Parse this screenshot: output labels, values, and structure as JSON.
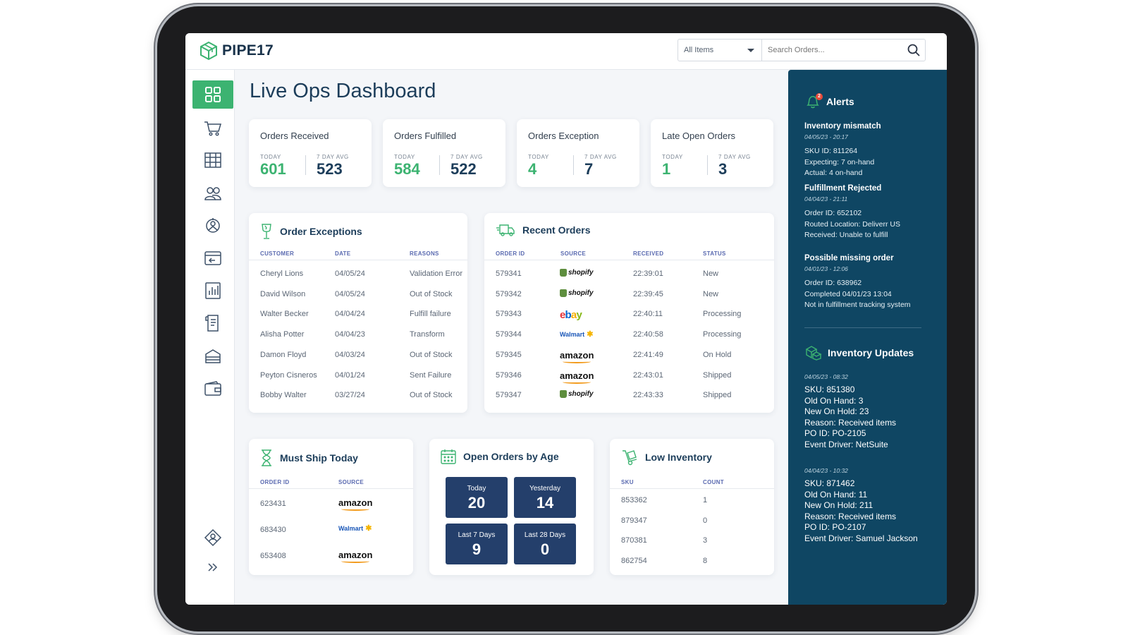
{
  "brand": {
    "name": "PIPE17",
    "accent": "#3cb371",
    "navy": "#0f4663"
  },
  "topbar": {
    "filter_value": "All Items",
    "search_placeholder": "Search Orders..."
  },
  "sidebar": {
    "items": [
      {
        "icon": "dashboard-grid-icon",
        "active": true
      },
      {
        "icon": "cart-icon"
      },
      {
        "icon": "table-grid-icon"
      },
      {
        "icon": "users-icon"
      },
      {
        "icon": "integration-icon"
      },
      {
        "icon": "returns-icon"
      },
      {
        "icon": "reports-icon"
      },
      {
        "icon": "receipt-icon"
      },
      {
        "icon": "inventory-icon"
      },
      {
        "icon": "wallet-icon"
      },
      {
        "icon": "support-icon"
      },
      {
        "icon": "expand-icon"
      }
    ]
  },
  "page": {
    "title": "Live Ops Dashboard"
  },
  "kpis": [
    {
      "title": "Orders Received",
      "today_label": "TODAY",
      "avg_label": "7 DAY AVG",
      "today": "601",
      "avg": "523",
      "today_color": "#3cb371"
    },
    {
      "title": "Orders Fulfilled",
      "today_label": "TODAY",
      "avg_label": "7 DAY AVG",
      "today": "584",
      "avg": "522",
      "today_color": "#3cb371"
    },
    {
      "title": "Orders Exception",
      "today_label": "TODAY",
      "avg_label": "7 DAY AVG",
      "today": "4",
      "avg": "7",
      "today_color": "#3cb371"
    },
    {
      "title": "Late Open Orders",
      "today_label": "TODAY",
      "avg_label": "7 DAY AVG",
      "today": "1",
      "avg": "3",
      "today_color": "#3cb371"
    }
  ],
  "order_exceptions": {
    "title": "Order Exceptions",
    "columns": [
      "CUSTOMER",
      "DATE",
      "REASONS"
    ],
    "rows": [
      [
        "Cheryl Lions",
        "04/05/24",
        "Validation Error"
      ],
      [
        "David Wilson",
        "04/05/24",
        "Out of Stock"
      ],
      [
        "Walter Becker",
        "04/04/24",
        "Fulfill failure"
      ],
      [
        "Alisha Potter",
        "04/04/23",
        "Transform"
      ],
      [
        "Damon Floyd",
        "04/03/24",
        "Out of Stock"
      ],
      [
        "Peyton Cisneros",
        "04/01/24",
        "Sent Failure"
      ],
      [
        "Bobby Walter",
        "03/27/24",
        "Out of Stock"
      ]
    ]
  },
  "recent_orders": {
    "title": "Recent Orders",
    "columns": [
      "ORDER ID",
      "SOURCE",
      "RECEIVED",
      "STATUS"
    ],
    "rows": [
      {
        "id": "579341",
        "source": "shopify",
        "received": "22:39:01",
        "status": "New"
      },
      {
        "id": "579342",
        "source": "shopify",
        "received": "22:39:45",
        "status": "New"
      },
      {
        "id": "579343",
        "source": "ebay",
        "received": "22:40:11",
        "status": "Processing"
      },
      {
        "id": "579344",
        "source": "Walmart",
        "received": "22:40:58",
        "status": "Processing"
      },
      {
        "id": "579345",
        "source": "amazon",
        "received": "22:41:49",
        "status": "On Hold"
      },
      {
        "id": "579346",
        "source": "amazon",
        "received": "22:43:01",
        "status": "Shipped"
      },
      {
        "id": "579347",
        "source": "shopify",
        "received": "22:43:33",
        "status": "Shipped"
      }
    ]
  },
  "must_ship": {
    "title": "Must Ship Today",
    "columns": [
      "ORDER ID",
      "SOURCE"
    ],
    "rows": [
      {
        "id": "623431",
        "source": "amazon"
      },
      {
        "id": "683430",
        "source": "Walmart"
      },
      {
        "id": "653408",
        "source": "amazon"
      }
    ]
  },
  "open_orders_age": {
    "title": "Open Orders by Age",
    "buckets": [
      {
        "label": "Today",
        "value": "20"
      },
      {
        "label": "Yesterday",
        "value": "14"
      },
      {
        "label": "Last 7 Days",
        "value": "9"
      },
      {
        "label": "Last 28 Days",
        "value": "0"
      }
    ]
  },
  "low_inventory": {
    "title": "Low Inventory",
    "columns": [
      "SKU",
      "COUNT"
    ],
    "rows": [
      [
        "853362",
        "1"
      ],
      [
        "879347",
        "0"
      ],
      [
        "870381",
        "3"
      ],
      [
        "862754",
        "8"
      ]
    ]
  },
  "alerts": {
    "title": "Alerts",
    "badge": "2",
    "items": [
      {
        "title": "Inventory mismatch",
        "date": "04/05/23 - 20:17",
        "lines": [
          "SKU ID: 811264",
          "Expecting: 7 on-hand",
          "Actual: 4 on-hand"
        ]
      },
      {
        "title": "Fulfillment Rejected",
        "date": "04/04/23 - 21:11",
        "lines": [
          "Order ID: 652102",
          "Routed Location: Deliverr US",
          "Received: Unable to fulfill"
        ]
      },
      {
        "title": "Possible missing order",
        "date": "04/01/23 - 12:06",
        "lines": [
          "Order ID: 638962",
          "Completed 04/01/23 13:04",
          "Not in fulfillment tracking system"
        ]
      }
    ]
  },
  "inventory_updates": {
    "title": "Inventory Updates",
    "items": [
      {
        "date": "04/05/23 - 08:32",
        "lines": [
          "SKU: 851380",
          "Old On Hand: 3",
          "New On Hold: 23",
          "Reason: Received items",
          "PO ID: PO-2105",
          "Event Driver: NetSuite"
        ]
      },
      {
        "date": "04/04/23 - 10:32",
        "lines": [
          "SKU: 871462",
          "Old On Hand: 11",
          "New On Hold: 211",
          "Reason: Received items",
          "PO ID: PO-2107",
          "Event Driver: Samuel Jackson"
        ]
      }
    ]
  }
}
